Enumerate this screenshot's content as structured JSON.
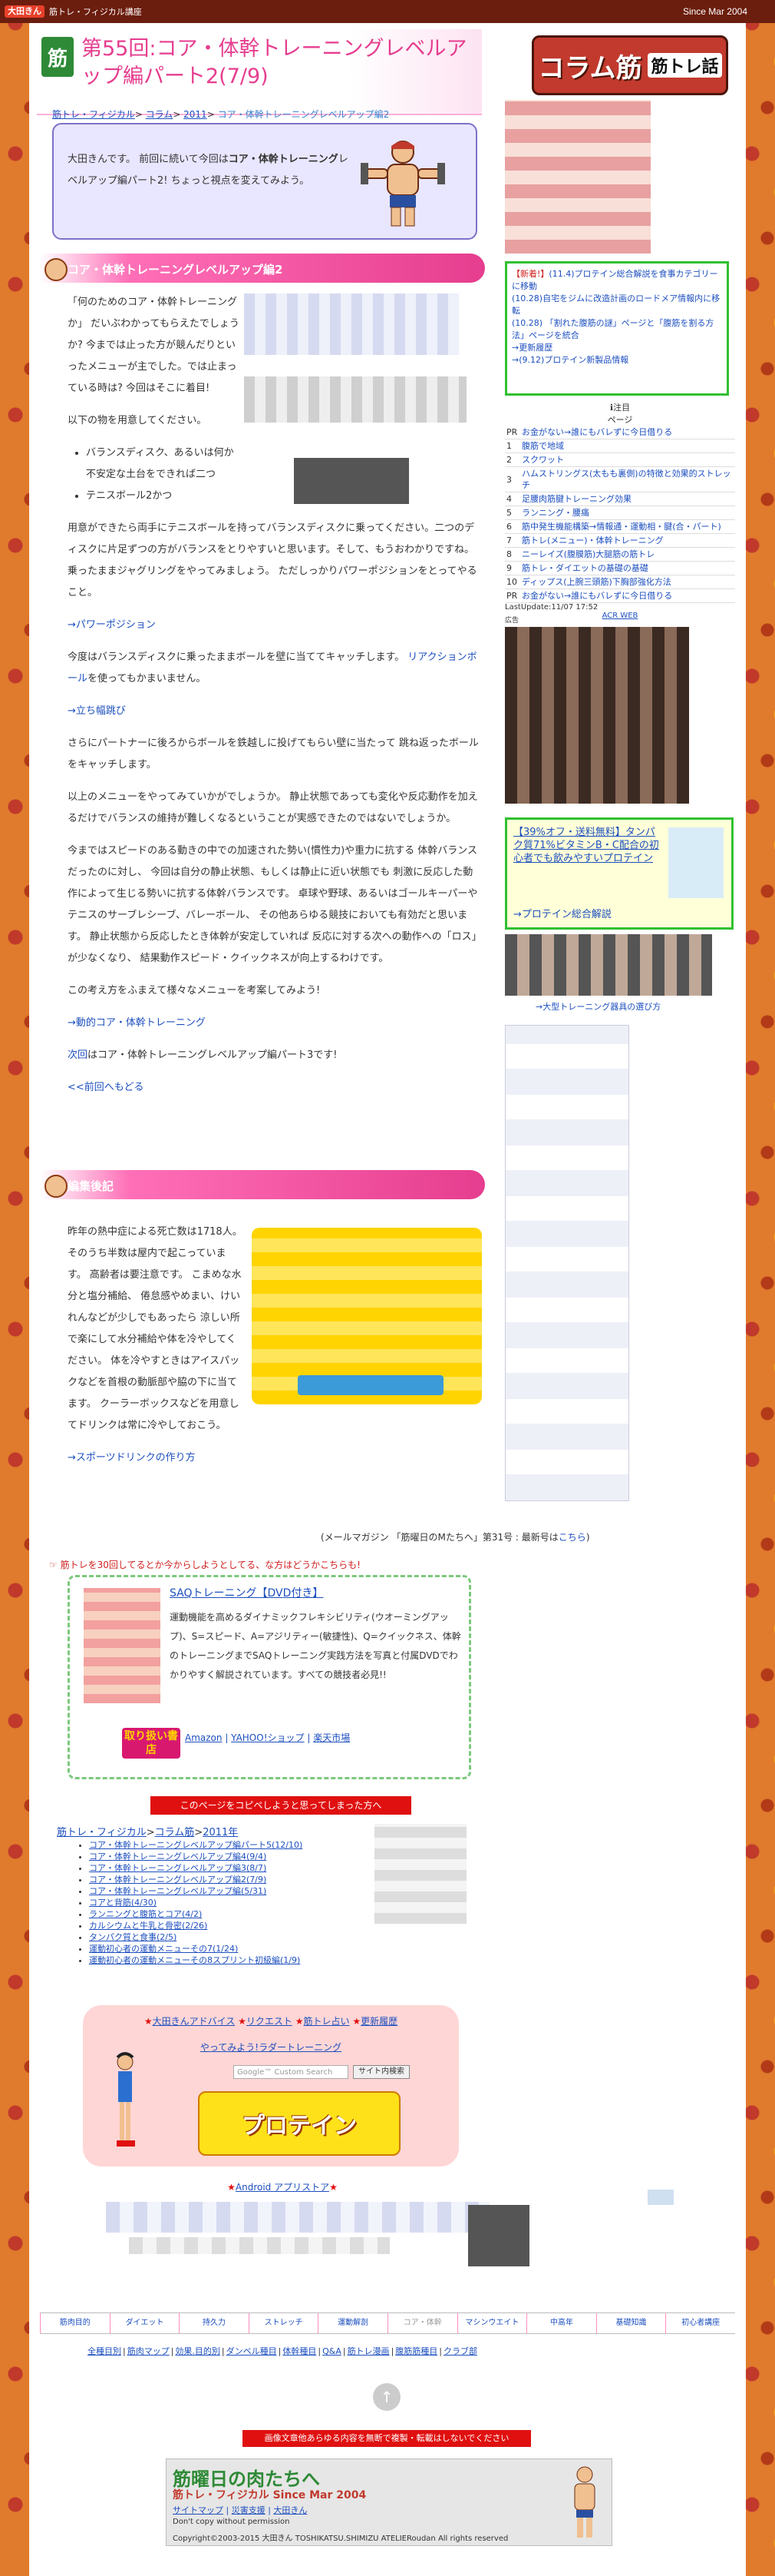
{
  "top_bar": {
    "logo_badge": "大田きん",
    "logo_text": "筋トレ・フィジカル講座",
    "since": "Since Mar 2004"
  },
  "header": {
    "icon_char": "筋",
    "title": "第55回:コア・体幹トレーニングレベルアップ編パート2(7/9)",
    "column_logo_big": "コラム筋",
    "column_logo_small": "筋トレ話"
  },
  "breadcrumb": {
    "items": [
      "筋トレ・フィジカル",
      "コラム",
      "2011"
    ],
    "current": "コア・体幹トレーニングレベルアップ編2"
  },
  "intro": {
    "text_pre": "大田きんです。 前回に続いて今回は",
    "text_bold": "コア・体幹トレーニング",
    "text_post": "レベルアップ編パート2! ちょっと視点を変えてみよう。"
  },
  "section1": {
    "heading": "コア・体幹トレーニングレベルアップ編2"
  },
  "main_text": {
    "p1": "「何のためのコア・体幹トレーニングか」 だいぶわかってもらえたでしょうか? 今までは止った方が競んだりといったメニューが主でした。では止まっている時は? 今回はそこに着目!",
    "p2": "以下の物を用意してください。",
    "items": [
      "バランスディスク、あるいは何か不安定な土台をできれば二つ",
      "テニスボール2かつ"
    ],
    "p3": "用意ができたら両手にテニスボールを持ってバランスディスクに乗ってください。二つのディスクに片足ずつの方がバランスをとりやすいと思います。そして、もうおわかりですね。乗ったままジャグリングをやってみましょう。 ただしっかりパワーポジションをとってやること。",
    "link1": "→パワーポジション",
    "p4": "今度はバランスディスクに乗ったままボールを壁に当ててキャッチします。",
    "p4_link": "リアクションボール",
    "p4_post": "を使ってもかまいません。",
    "link2": "→立ち幅跳び",
    "p5": "さらにパートナーに後ろからボールを鉄越しに投げてもらい壁に当たって 跳ね返ったボールをキャッチします。",
    "p6": "以上のメニューをやってみていかがでしょうか。 静止状態であっても変化や反応動作を加えるだけでバランスの維持が難しくなるということが実感できたのではないでしょうか。",
    "p7": "今まではスピードのある動きの中での加速された勢い(慣性力)や重力に抗する 体幹バランスだったのに対し、 今回は自分の静止状態、もしくは静止に近い状態でも 刺激に反応した動作によって生じる勢いに抗する体幹バランスです。 卓球や野球、あるいはゴールキーパーやテニスのサーブレシーブ、バレーボール、 その他あらゆる競技においても有効だと思います。 静止状態から反応したとき体幹が安定していれば 反応に対する次への動作への「ロス」が少なくなり、 結果動作スピード・クイックネスが向上するわけです。",
    "p8": "この考え方をふまえて様々なメニューを考案してみよう!",
    "link3": "→動的コア・体幹トレーニング",
    "next_pre": "次回",
    "next_post": "はコア・体幹トレーニングレベルアップ編パート3です!",
    "prev": "<<前回へもどる"
  },
  "section2": {
    "heading": "編集後記"
  },
  "after": {
    "text": "昨年の熱中症による死亡数は1718人。そのうち半数は屋内で起こっています。 高齢者は要注意です。 こまめな水分と塩分補給、 倦怠感やめまい、けいれんなどが少しでもあったら 涼しい所で楽にして水分補給や体を冷やしてください。 体を冷やすときはアイスパックなどを首根の動脈部や脇の下に当てます。 クーラーボックスなどを用意してドリンクは常に冷やしておこう。",
    "link": "→スポーツドリンクの作り方"
  },
  "magazine": {
    "text": "(メールマガジン 「筋曜日のMたちへ」第31号 : 最新号は",
    "link": "こちら",
    "close": ")"
  },
  "share": {
    "text": "筋トレを30回してるとか今からしようとしてる、な方はどうかこちらも!"
  },
  "saq": {
    "title": "SAQトレーニング【DVD付き】",
    "desc": "運動機能を高めるダイナミックフレキシビリティ(ウオーミングアップ)、S=スピード、A=アジリティー(敏捷性)、Q=クイックネス、体幹のトレーニングまでSAQトレーニング実践方法を写真と付属DVDでわかりやすく解説されています。すべての競技者必見!!",
    "shop_label": "取り扱い書店",
    "shops": [
      "Amazon",
      "YAHOO!ショップ",
      "楽天市場"
    ]
  },
  "copy_warning": "このページをコピペしようと思ってしまった方へ",
  "series": {
    "crumb": [
      "筋トレ・フィジカル",
      "コラム筋",
      "2011年"
    ],
    "list": [
      "コア・体幹トレーニングレベルアップ編パート5(12/10)",
      "コア・体幹トレーニングレベルアップ編4(9/4)",
      "コア・体幹トレーニングレベルアップ編3(8/7)",
      "コア・体幹トレーニングレベルアップ編2(7/9)",
      "コア・体幹トレーニングレベルアップ編(5/31)",
      "コアと背筋(4/30)",
      "ランニングと腹筋とコア(4/2)",
      "カルシウムと牛乳と骨密(2/26)",
      "タンパク質と食事(2/5)",
      "運動初心者の運動メニューその7(1/24)",
      "運動初心者の運動メニューその8スプリント初級編(1/9)"
    ]
  },
  "pink_panel": {
    "links": [
      "大田きんアドバイス",
      "リクエスト",
      "筋トレ占い",
      "更新履歴"
    ],
    "yatte": "やってみよう!ラダートレーニング",
    "search_placeholder": "Google™ Custom Search",
    "search_button": "サイト内検索",
    "protein": "プロテイン"
  },
  "android": "Android アプリストア",
  "nav_tabs": [
    "筋肉目的",
    "ダイエット",
    "持久力",
    "ストレッチ",
    "運動解剖",
    "コア・体幹",
    "マシンウエイト",
    "中高年",
    "基礎知識",
    "初心者講座"
  ],
  "sub_nav": [
    "全種目別",
    "筋肉マップ",
    "効果.目的別",
    "ダンベル種目",
    "体幹種目",
    "Q&A",
    "筋トレ漫画",
    "腹筋筋種目",
    "クラブ部"
  ],
  "no_copy": "画像文章他あらゆる内容を無断で複製・転載はしないでください",
  "footer": {
    "t1": "筋曜日の肉たちへ",
    "t2": "筋トレ・フィジカル Since Mar 2004",
    "links": [
      "サイトマップ",
      "災害支援",
      "大田きん"
    ],
    "dc": "Don't copy without permission",
    "cp": "Copyright©2003-2015 大田きん TOSHIKATSU.SHIMIZU ATELIERoudan All rights reserved"
  },
  "news": {
    "items": [
      {
        "badge": "【新着!】",
        "text": "(11.4)プロテイン総合解説を食事カテゴリーに移動"
      },
      {
        "badge": "",
        "text": "(10.28)自宅をジムに改造計画のロードメア情報内に移転"
      },
      {
        "badge": "",
        "text": "(10.28) 「割れた腹筋の謎」ページと「腹筋を割る方法」ページを統合"
      }
    ],
    "more": "→更新履歴",
    "last": "→(9.12)プロテイン新製品情報"
  },
  "ranking": {
    "header": "注目",
    "sub": "ページ",
    "rows": [
      {
        "n": "PR",
        "t": "お金がない→誰にもバレずに今日借りる"
      },
      {
        "n": "1",
        "t": "腹筋で地域"
      },
      {
        "n": "2",
        "t": "スクワット"
      },
      {
        "n": "3",
        "t": "ハムストリングス(太もも裏側)の特徴と効果的ストレッチ"
      },
      {
        "n": "4",
        "t": "足腰肉筋腱トレーニング効果"
      },
      {
        "n": "5",
        "t": "ランニング・腰痛"
      },
      {
        "n": "6",
        "t": "筋中発生機能構築→情報通・運動相・腱(合・パート)"
      },
      {
        "n": "7",
        "t": "筋トレ(メニュー)・体幹トレーニング"
      },
      {
        "n": "8",
        "t": "ニーレイズ(腹膜筋)大腿筋の筋トレ"
      },
      {
        "n": "9",
        "t": "筋トレ・ダイエットの基礎の基礎"
      },
      {
        "n": "10",
        "t": "ディップス(上腕三頭筋)下胸部強化方法"
      },
      {
        "n": "PR",
        "t": "お金がない→誰にもバレずに今日借りる"
      }
    ],
    "update": "LastUpdate:11/07 17:52",
    "acr": "ACR WEB"
  },
  "ad_label": "広告",
  "promo": {
    "text": "【39%オフ・送料無料】タンパク質71%ビタミンB・C配合の初心者でも飲みやすいプロテイン",
    "link": "→プロテイン総合解説"
  },
  "tool_caption": "→大型トレーニング器具の選び方"
}
